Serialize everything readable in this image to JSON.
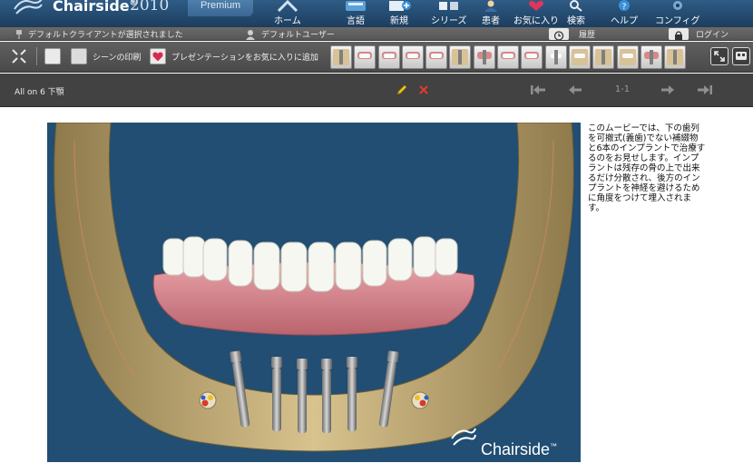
{
  "brand": {
    "name": "Chairside",
    "year": "2010",
    "edition": "Premium"
  },
  "nav": [
    {
      "label": "ホーム",
      "icon": "home-icon"
    },
    {
      "label": "言語",
      "icon": "language-icon"
    },
    {
      "label": "新規",
      "icon": "new-icon"
    },
    {
      "label": "シリーズ",
      "icon": "series-icon"
    },
    {
      "label": "患者",
      "icon": "patient-icon"
    },
    {
      "label": "お気に入り",
      "icon": "favorites-icon"
    },
    {
      "label": "検索",
      "icon": "search-icon"
    },
    {
      "label": "ヘルプ",
      "icon": "help-icon"
    },
    {
      "label": "コンフィグ",
      "icon": "config-icon"
    }
  ],
  "status": {
    "client": "デフォルトクライアントが選択されました",
    "user": "デフォルトユーザー",
    "history": "履歴",
    "login": "ログイン"
  },
  "toolbar": {
    "print_scene": "シーンの印刷",
    "add_favorite": "プレゼンテーションをお気に入りに追加"
  },
  "player": {
    "scene_title": "All on 6 下顎",
    "page": "1-1"
  },
  "content": {
    "watermark": "Chairside",
    "description": "このムービーでは、下の歯列を可撤式(義歯)でない補綴物と6本のインプラントで治療するのをお見せします。インプラントは残存の骨の上で出来るだけ分散され、後方のインプラントを神経を避けるために角度をつけて埋入されます。"
  },
  "colors": {
    "header_blue": "#2f5c86",
    "toolbar_gray": "#555555",
    "player_gray": "#424242",
    "stage_blue": "#214e72",
    "edit_yellow": "#f2c200",
    "close_red": "#e03a2a"
  }
}
